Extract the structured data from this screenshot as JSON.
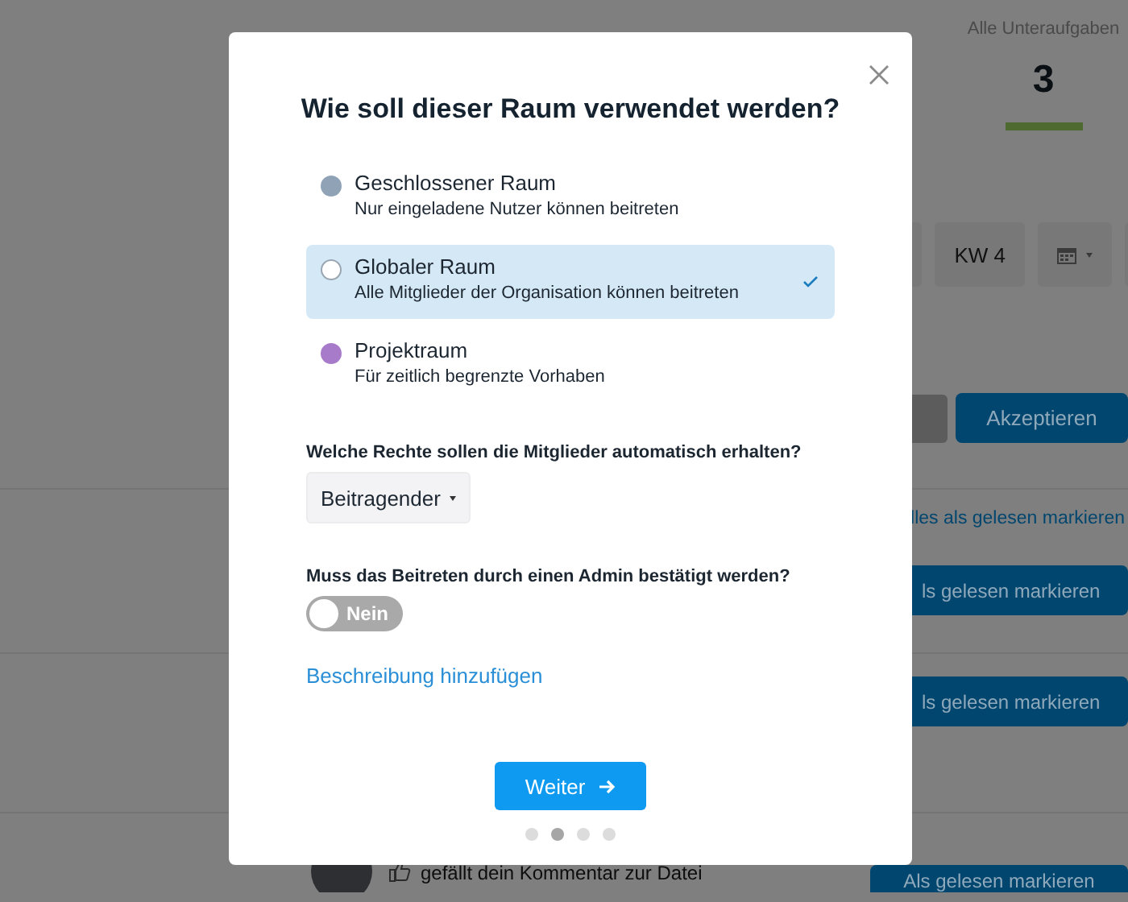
{
  "background": {
    "stat": {
      "label": "Alle Unteraufgaben",
      "value": "3",
      "level": 1
    },
    "toolbar": [
      {
        "kind": "text",
        "label": "KW 4"
      },
      {
        "kind": "calendar"
      }
    ],
    "accept_button": "Akzeptieren",
    "mark_all_link": "lles als gelesen markieren",
    "notifications": [
      {
        "button": "ls gelesen markieren"
      },
      {
        "button": "ls gelesen markieren"
      }
    ],
    "last_notification": {
      "text": "gefällt dein Kommentar zur Datei",
      "button": "Als gelesen markieren"
    }
  },
  "dialog": {
    "title": "Wie soll dieser Raum verwendet werden?",
    "options": [
      {
        "title": "Geschlossener Raum",
        "subtitle": "Nur eingeladene Nutzer können beitreten",
        "color": "#8fa2b6",
        "selected": false
      },
      {
        "title": "Globaler Raum",
        "subtitle": "Alle Mitglieder der Organisation können beitreten",
        "color": "#9aa6b2",
        "selected": true
      },
      {
        "title": "Projektraum",
        "subtitle": "Für zeitlich begrenzte Vorhaben",
        "color": "#a77bc9",
        "selected": false
      }
    ],
    "rights_label": "Welche Rechte sollen die Mitglieder automatisch erhalten?",
    "rights_value": "Beitragender",
    "approval_label": "Muss das Beitreten durch einen Admin bestätigt werden?",
    "approval_toggle": {
      "on": false,
      "label": "Nein"
    },
    "description_link": "Beschreibung hinzufügen",
    "next_button": "Weiter",
    "steps": [
      {
        "selected": false
      },
      {
        "selected": true
      },
      {
        "selected": false
      },
      {
        "selected": false
      }
    ]
  }
}
